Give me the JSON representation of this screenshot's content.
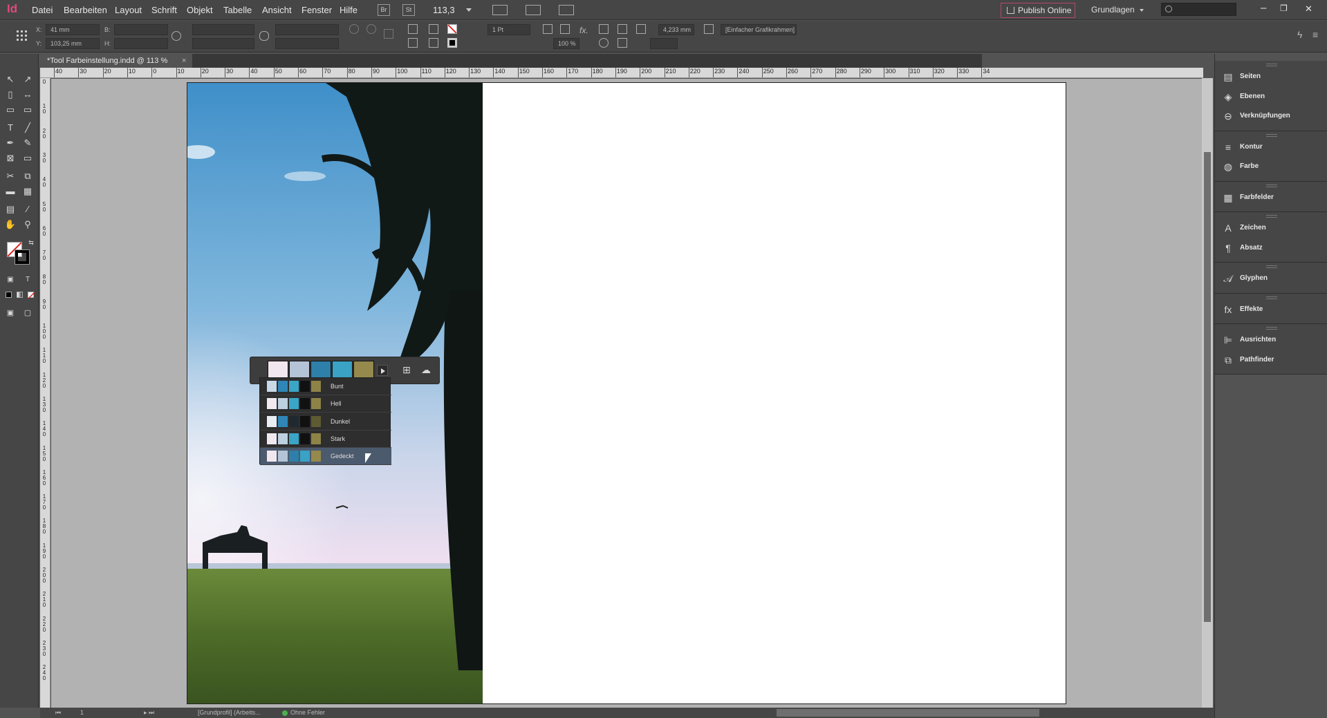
{
  "app": {
    "logo": "Id"
  },
  "menu": [
    "Datei",
    "Bearbeiten",
    "Layout",
    "Schrift",
    "Objekt",
    "Tabelle",
    "Ansicht",
    "Fenster",
    "Hilfe"
  ],
  "menubar": {
    "bridge_label": "Br",
    "stock_label": "St",
    "zoom": "113,3",
    "publish_label": "Publish Online",
    "workspace": "Grundlagen",
    "win_min": "–",
    "win_restore": "❐",
    "win_close": "✕"
  },
  "control": {
    "x_label": "X:",
    "x_value": "41 mm",
    "y_label": "Y:",
    "y_value": "103,25 mm",
    "w_label": "B:",
    "h_label": "H:",
    "stroke_weight": "1 Pt",
    "opacity": "100 %",
    "offset": "4,233 mm",
    "frame_style": "[Einfacher Grafikrahmen]"
  },
  "document": {
    "tab_title": "*Tool Farbeinstellung.indd @ 113 %",
    "tab_close": "×"
  },
  "ruler": {
    "top_labels": [
      "40",
      "30",
      "20",
      "10",
      "0",
      "10",
      "20",
      "30",
      "40",
      "50",
      "60",
      "70",
      "80",
      "90",
      "100",
      "110",
      "120",
      "130",
      "140",
      "150",
      "160",
      "170",
      "180",
      "190",
      "200",
      "210",
      "220",
      "230",
      "240",
      "250",
      "260",
      "270",
      "280",
      "290",
      "300",
      "310",
      "320",
      "330",
      "34"
    ],
    "left_labels": [
      "0",
      "1 0",
      "2 0",
      "3 0",
      "4 0",
      "5 0",
      "6 0",
      "7 0",
      "8 0",
      "9 0",
      "1 0 0",
      "1 1 0",
      "1 2 0",
      "1 3 0",
      "1 4 0",
      "1 5 0",
      "1 6 0",
      "1 7 0",
      "1 8 0",
      "1 9 0",
      "2 0 0",
      "2 1 0",
      "2 2 0",
      "2 3 0",
      "2 4 0"
    ]
  },
  "color_theme": {
    "swatches": [
      "#f1e7ee",
      "#b5c3d6",
      "#2e7faa",
      "#3aa2c4",
      "#958a4c"
    ],
    "themes": [
      {
        "name": "Bunt",
        "colors": [
          "#c9d9e6",
          "#2f86b7",
          "#3aa5c6",
          "#111111",
          "#8d8346"
        ]
      },
      {
        "name": "Hell",
        "colors": [
          "#f0eaf0",
          "#bcd0df",
          "#3aa5c6",
          "#111111",
          "#8d8346"
        ]
      },
      {
        "name": "Dunkel",
        "colors": [
          "#e8eef2",
          "#2f86b7",
          "#1e2a30",
          "#111111",
          "#5e5a32"
        ]
      },
      {
        "name": "Stark",
        "colors": [
          "#f0eaf0",
          "#bcd0df",
          "#3aa5c6",
          "#111111",
          "#8d8346"
        ]
      },
      {
        "name": "Gedeckt",
        "colors": [
          "#f1e7ee",
          "#b5c3d6",
          "#2e7faa",
          "#3aa2c4",
          "#958a4c"
        ]
      }
    ],
    "selected": "Gedeckt"
  },
  "panels": [
    {
      "group": [
        {
          "label": "Seiten",
          "icon": "pages-icon",
          "glyph": "▤"
        },
        {
          "label": "Ebenen",
          "icon": "layers-icon",
          "glyph": "◈"
        },
        {
          "label": "Verknüpfungen",
          "icon": "links-icon",
          "glyph": "⊖"
        }
      ]
    },
    {
      "group": [
        {
          "label": "Kontur",
          "icon": "stroke-icon",
          "glyph": "≡"
        },
        {
          "label": "Farbe",
          "icon": "color-icon",
          "glyph": "◍"
        }
      ]
    },
    {
      "group": [
        {
          "label": "Farbfelder",
          "icon": "swatches-icon",
          "glyph": "▦"
        }
      ]
    },
    {
      "group": [
        {
          "label": "Zeichen",
          "icon": "character-icon",
          "glyph": "A"
        },
        {
          "label": "Absatz",
          "icon": "paragraph-icon",
          "glyph": "¶"
        }
      ]
    },
    {
      "group": [
        {
          "label": "Glyphen",
          "icon": "glyphs-icon",
          "glyph": "𝒜"
        }
      ]
    },
    {
      "group": [
        {
          "label": "Effekte",
          "icon": "effects-icon",
          "glyph": "fx"
        }
      ]
    },
    {
      "group": [
        {
          "label": "Ausrichten",
          "icon": "align-icon",
          "glyph": "⊫"
        },
        {
          "label": "Pathfinder",
          "icon": "pathfinder-icon",
          "glyph": "⧉"
        }
      ]
    }
  ],
  "status": {
    "page": "1",
    "profile": "[Grundprofil] (Arbeits...",
    "preflight": "Ohne Fehler",
    "preflight_color": "#4caf50"
  }
}
